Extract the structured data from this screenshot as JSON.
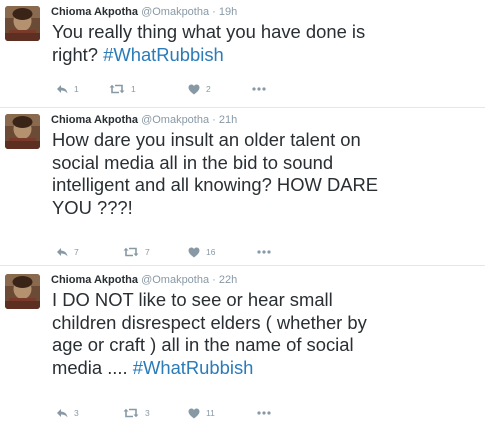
{
  "colors": {
    "name": "#292f33",
    "meta": "#8899a6",
    "hashtag": "#2b7bb9",
    "divider": "#e1e8ed"
  },
  "tweets": [
    {
      "name": "Chioma Akpotha",
      "handle": "@Omakpotha",
      "separator": "·",
      "time": "19h",
      "text": "You really thing what you have done is\nright? ",
      "hashtag": "#WhatRubbish",
      "replies": "1",
      "retweets": "1",
      "likes": "2",
      "icons": [
        "avatar",
        "reply-icon",
        "retweet-icon",
        "heart-icon",
        "more-icon"
      ]
    },
    {
      "name": "Chioma Akpotha",
      "handle": "@Omakpotha",
      "separator": "·",
      "time": "21h",
      "text": "How dare you insult an older talent on\nsocial media all in the bid to sound\nintelligent and all knowing? HOW DARE\nYOU ???!",
      "hashtag": "",
      "replies": "7",
      "retweets": "7",
      "likes": "16",
      "icons": [
        "avatar",
        "reply-icon",
        "retweet-icon",
        "heart-icon",
        "more-icon"
      ]
    },
    {
      "name": "Chioma Akpotha",
      "handle": "@Omakpotha",
      "separator": "·",
      "time": "22h",
      "text": "I DO NOT like to see or hear small\nchildren disrespect elders ( whether by\nage or craft ) all in the name of social\nmedia .... ",
      "hashtag": "#WhatRubbish",
      "replies": "3",
      "retweets": "3",
      "likes": "11",
      "icons": [
        "avatar",
        "reply-icon",
        "retweet-icon",
        "heart-icon",
        "more-icon"
      ]
    }
  ]
}
